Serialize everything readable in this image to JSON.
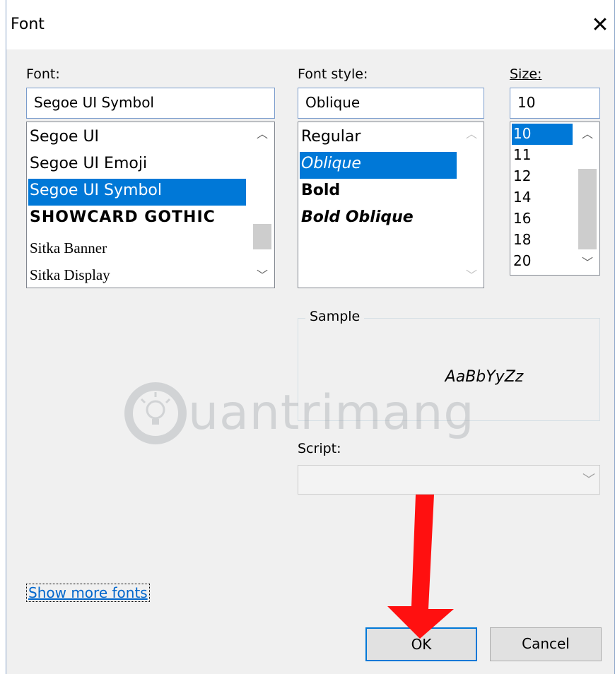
{
  "window": {
    "title": "Font",
    "close_glyph": "✕"
  },
  "font": {
    "label": "Font:",
    "value": "Segoe UI Symbol",
    "items": [
      "Segoe UI",
      "Segoe UI Emoji",
      "Segoe UI Symbol",
      "SHOWCARD GOTHIC",
      "Sitka Banner",
      "Sitka Display"
    ],
    "selected": "Segoe UI Symbol"
  },
  "style": {
    "label": "Font style:",
    "value": "Oblique",
    "items": [
      "Regular",
      "Oblique",
      "Bold",
      "Bold Oblique"
    ],
    "selected": "Oblique"
  },
  "size": {
    "label": "Size:",
    "value": "10",
    "items": [
      "10",
      "11",
      "12",
      "14",
      "16",
      "18",
      "20"
    ],
    "selected": "10"
  },
  "sample": {
    "label": "Sample",
    "text": "AaBbYyZz"
  },
  "script": {
    "label": "Script:",
    "value": ""
  },
  "link": {
    "label": "Show more fonts"
  },
  "buttons": {
    "ok": "OK",
    "cancel": "Cancel"
  },
  "watermark": {
    "text": "uantrimang"
  },
  "colors": {
    "selection": "#0078d7",
    "arrow": "#ff0000",
    "link": "#0066cc"
  },
  "icons": {
    "scroll_up": "scroll-up-icon",
    "scroll_down": "scroll-down-icon",
    "dropdown": "chevron-down-icon"
  }
}
